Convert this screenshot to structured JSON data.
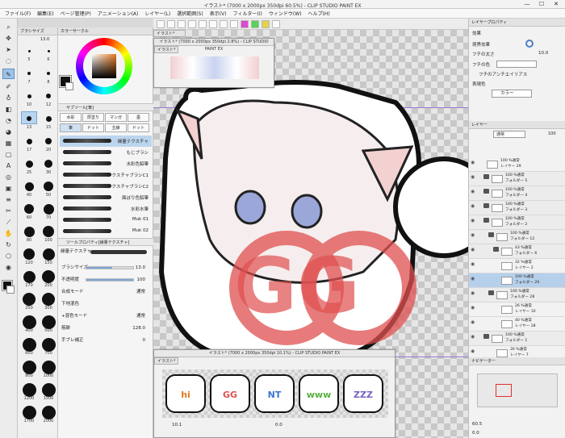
{
  "app": {
    "title": "イラスト* (7000 x 2000px 350dpi 60.5%) - CLIP STUDIO PAINT EX"
  },
  "window_controls": {
    "minimize": "—",
    "maximize": "☐",
    "close": "✕"
  },
  "menu": [
    "ファイル(F)",
    "編集(E)",
    "ページ管理(P)",
    "アニメーション(A)",
    "レイヤー(L)",
    "選択範囲(S)",
    "表示(V)",
    "フィルター(I)",
    "ウィンドウ(W)",
    "ヘルプ(H)"
  ],
  "brush_size_panel": {
    "tab": "ブラシサイズ",
    "top_value": "13.0",
    "sizes": [
      {
        "v": "5",
        "d": 3
      },
      {
        "v": "6",
        "d": 3
      },
      {
        "v": "7",
        "d": 4
      },
      {
        "v": "8",
        "d": 4
      },
      {
        "v": "10",
        "d": 5
      },
      {
        "v": "12",
        "d": 6
      },
      {
        "v": "13",
        "d": 6
      },
      {
        "v": "15",
        "d": 7
      },
      {
        "v": "17",
        "d": 7
      },
      {
        "v": "20",
        "d": 8
      },
      {
        "v": "25",
        "d": 9
      },
      {
        "v": "30",
        "d": 10
      },
      {
        "v": "40",
        "d": 11
      },
      {
        "v": "50",
        "d": 12
      },
      {
        "v": "60",
        "d": 12
      },
      {
        "v": "70",
        "d": 13
      },
      {
        "v": "80",
        "d": 13
      },
      {
        "v": "100",
        "d": 14
      },
      {
        "v": "120",
        "d": 14
      },
      {
        "v": "150",
        "d": 15
      },
      {
        "v": "170",
        "d": 15
      },
      {
        "v": "200",
        "d": 16
      },
      {
        "v": "250",
        "d": 16
      },
      {
        "v": "300",
        "d": 16
      },
      {
        "v": "400",
        "d": 17
      },
      {
        "v": "500",
        "d": 17
      },
      {
        "v": "600",
        "d": 17
      },
      {
        "v": "700",
        "d": 17
      },
      {
        "v": "800",
        "d": 17
      },
      {
        "v": "1000",
        "d": 17
      },
      {
        "v": "1200",
        "d": 17
      },
      {
        "v": "1500",
        "d": 17
      },
      {
        "v": "1700",
        "d": 17
      },
      {
        "v": "2000",
        "d": 17
      }
    ]
  },
  "color_panel": {
    "tab": "カラーサークル",
    "hue": "#e87a20"
  },
  "sub_tool_panel": {
    "tab": "サブツール[筆]",
    "groups": [
      "水彩",
      "厚塗り",
      "マンガ",
      "墨",
      "筆",
      "ドット",
      "主線",
      "ドット"
    ],
    "brushes": [
      {
        "name": "縁量テクスチャ",
        "sel": true
      },
      {
        "name": "もじブラシ"
      },
      {
        "name": "水彩色鉛筆"
      },
      {
        "name": "テクスチャブラシC1"
      },
      {
        "name": "テクスチャブラシC2"
      },
      {
        "name": "面ぼり色鉛筆"
      },
      {
        "name": "水彩水筆"
      },
      {
        "name": "Muk 01"
      },
      {
        "name": "Muk 02"
      }
    ]
  },
  "tool_property": {
    "tab": "ツールプロパティ[縁量テクスチャ]",
    "brush_name": "縁量テクスチャ",
    "rows": [
      {
        "label": "ブラシサイズ",
        "value": "13.0",
        "fill": 0.55
      },
      {
        "label": "不透明度",
        "value": "100",
        "fill": 1.0
      },
      {
        "label": "合成モード",
        "value": "通常"
      },
      {
        "label": "下地混色",
        "value": ""
      },
      {
        "label": "+混色モード",
        "value": "通常"
      },
      {
        "label": "筋跡",
        "value": "128.0"
      },
      {
        "label": "手ブレ補正",
        "value": "0"
      }
    ]
  },
  "canvas": {
    "tab": "イラスト*",
    "overlay_text": "GG",
    "overlay_color": "#e05050"
  },
  "nav_window": {
    "title": "イラスト* (7000 x 2000px 350dpi 2.8%) - CLIP STUDIO PAINT EX",
    "tab": "イラスト*"
  },
  "bottom_window": {
    "title": "イラスト* (7000 x 2000px 350dpi 10.1%) - CLIP STUDIO PAINT EX",
    "tab": "イラスト*",
    "stamps": [
      "hi",
      "GG",
      "NT",
      "www",
      "ZZZ"
    ],
    "zoom": "10.1",
    "angle": "0.0"
  },
  "layer_property": {
    "tab": "レイヤープロパティ",
    "effect": "効果",
    "border_effect": "境界効果",
    "border_width_label": "フチの太さ",
    "border_width": "10.0",
    "border_color_label": "フチの色",
    "antialias": "フチのアンチエイリアス",
    "expr_color_label": "表現色",
    "expr_color": "カラー"
  },
  "layers_panel": {
    "tab": "レイヤー",
    "blend": "通常",
    "opacity": "100",
    "rows": [
      {
        "pct": "100 %通常",
        "name": "レイヤー 29",
        "type": "layer",
        "ind": 0
      },
      {
        "pct": "100 %通常",
        "name": "フォルダー 5",
        "type": "folder",
        "ind": 1
      },
      {
        "pct": "100 %通常",
        "name": "フォルダー 4",
        "type": "folder",
        "ind": 1
      },
      {
        "pct": "100 %通常",
        "name": "フォルダー 3",
        "type": "folder",
        "ind": 1
      },
      {
        "pct": "100 %通常",
        "name": "フォルダー 2",
        "type": "folder",
        "ind": 1
      },
      {
        "pct": "100 %通常",
        "name": "フォルダー 12",
        "type": "folder",
        "ind": 2
      },
      {
        "pct": "43 %通常",
        "name": "フォルダー 6",
        "type": "folder",
        "ind": 3
      },
      {
        "pct": "32 %通常",
        "name": "レイヤー 2",
        "type": "layer",
        "ind": 3
      },
      {
        "pct": "100 %通常",
        "name": "フォルダー 20",
        "type": "layer",
        "ind": 3,
        "sel": true
      },
      {
        "pct": "100 %通常",
        "name": "フォルダー 28",
        "type": "folder",
        "ind": 2
      },
      {
        "pct": "26 %通常",
        "name": "レイヤー 10",
        "type": "layer",
        "ind": 3
      },
      {
        "pct": "40 %通常",
        "name": "レイヤー 28",
        "type": "layer",
        "ind": 3
      },
      {
        "pct": "100 %通常",
        "name": "フォルダー 1",
        "type": "folder",
        "ind": 1
      },
      {
        "pct": "26 %通常",
        "name": "レイヤー 7",
        "type": "layer",
        "ind": 2
      }
    ]
  },
  "navigator": {
    "tab": "ナビゲーター",
    "zoom": "60.5",
    "angle": "0.0"
  }
}
